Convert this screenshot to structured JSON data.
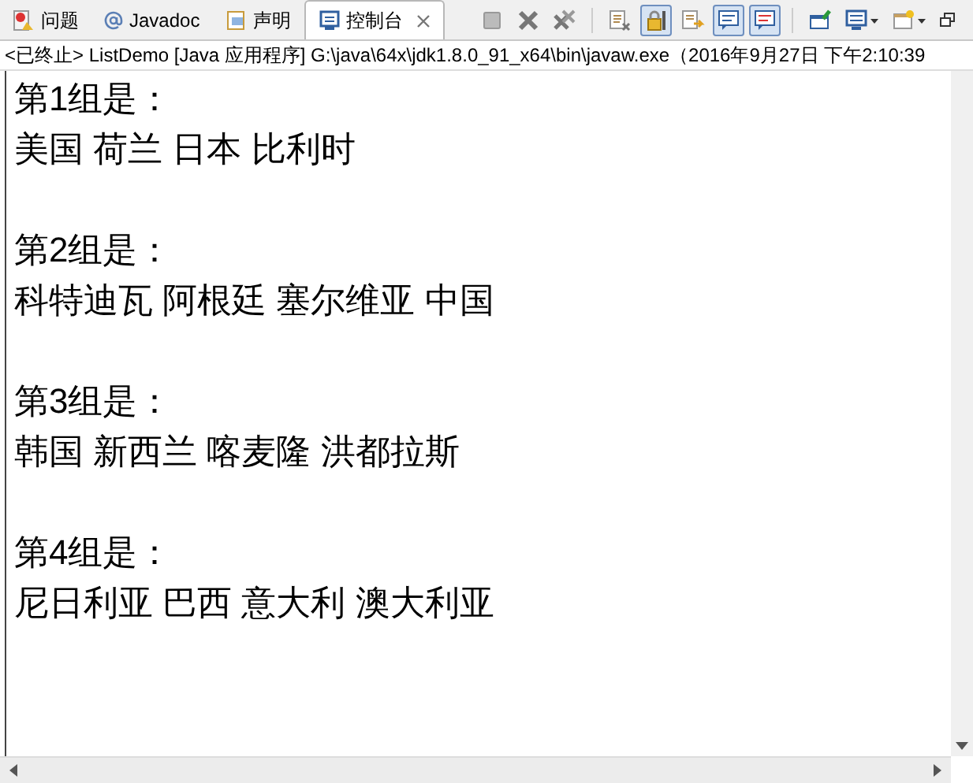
{
  "tabs": [
    {
      "label": "问题",
      "kind": "problems",
      "selected": false
    },
    {
      "label": "Javadoc",
      "kind": "javadoc",
      "selected": false
    },
    {
      "label": "声明",
      "kind": "declaration",
      "selected": false
    },
    {
      "label": "控制台",
      "kind": "console",
      "selected": true
    }
  ],
  "toolbar": [
    {
      "kind": "terminate"
    },
    {
      "kind": "remove"
    },
    {
      "kind": "remove-all"
    },
    {
      "kind": "sep"
    },
    {
      "kind": "clear"
    },
    {
      "kind": "lock",
      "pressed": true
    },
    {
      "kind": "wrap",
      "pressed": false
    },
    {
      "kind": "show-out",
      "pressed": true
    },
    {
      "kind": "show-err",
      "pressed": true
    },
    {
      "kind": "sep"
    },
    {
      "kind": "pin"
    },
    {
      "kind": "display"
    },
    {
      "kind": "new"
    },
    {
      "kind": "restore"
    }
  ],
  "process_line": "<已终止> ListDemo [Java 应用程序] G:\\java\\64x\\jdk1.8.0_91_x64\\bin\\javaw.exe（2016年9月27日 下午2:10:39",
  "groups": [
    {
      "heading": "第1组是：",
      "members": "美国 荷兰 日本 比利时"
    },
    {
      "heading": "第2组是：",
      "members": "科特迪瓦 阿根廷 塞尔维亚 中国"
    },
    {
      "heading": "第3组是：",
      "members": "韩国 新西兰 喀麦隆 洪都拉斯"
    },
    {
      "heading": "第4组是：",
      "members": "尼日利亚 巴西 意大利 澳大利亚"
    }
  ]
}
